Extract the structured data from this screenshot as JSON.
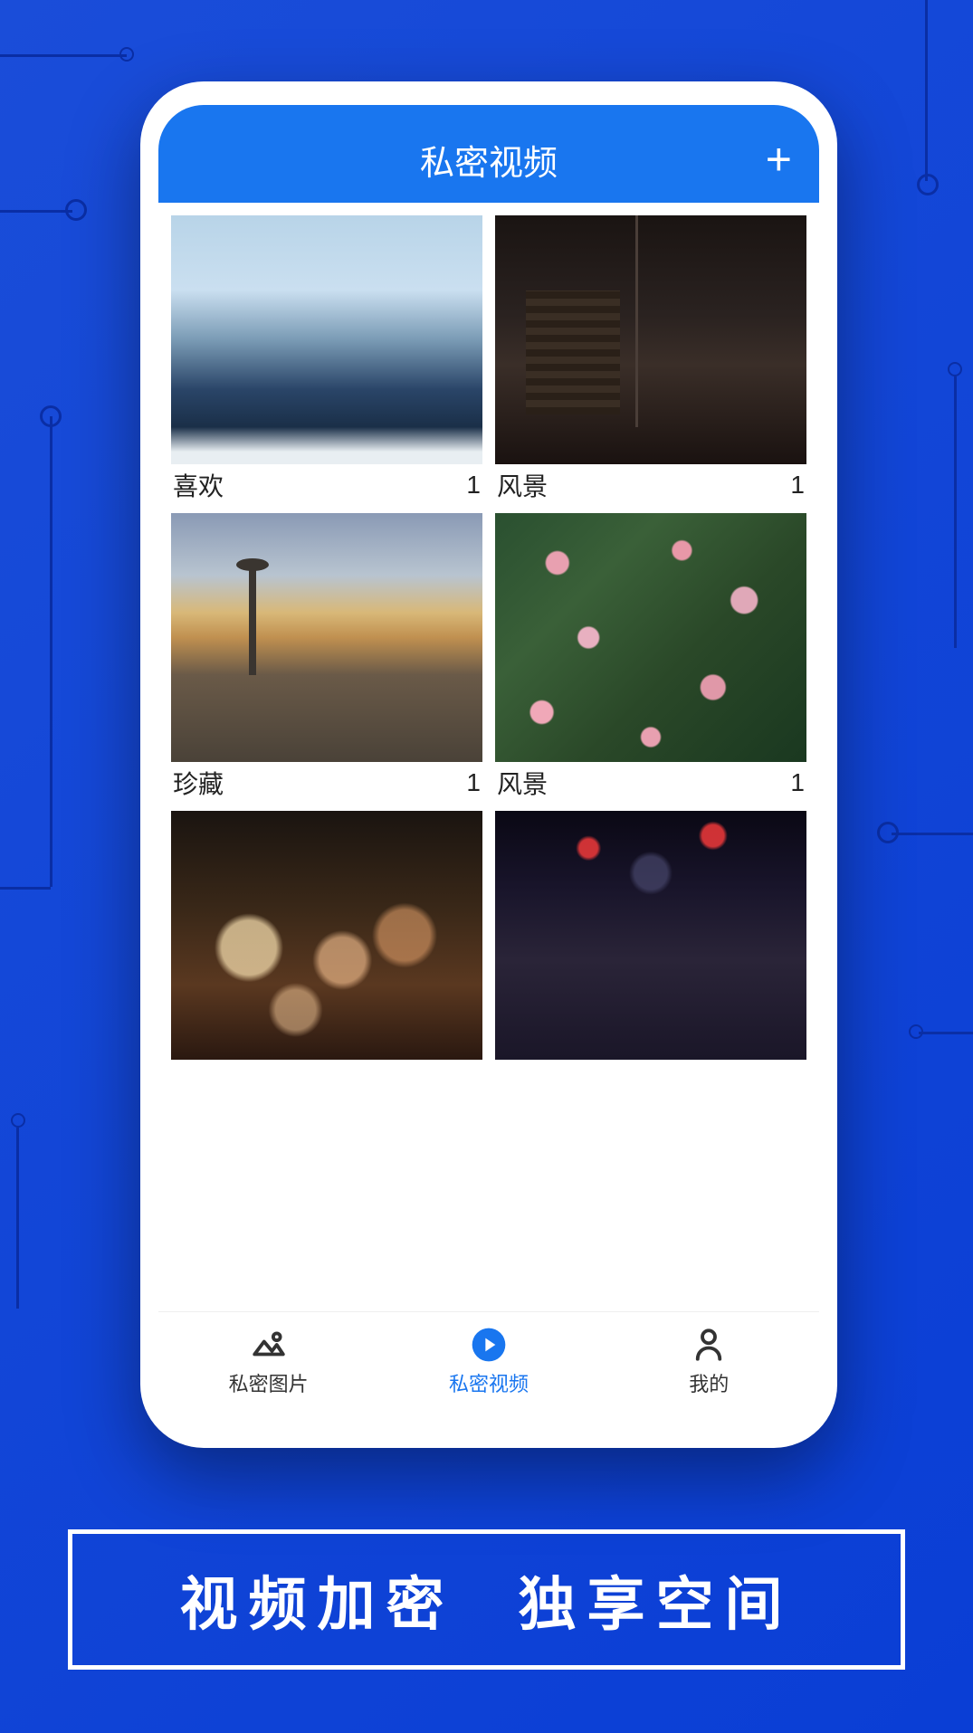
{
  "header": {
    "title": "私密视频",
    "add_icon": "plus-icon"
  },
  "albums": [
    {
      "label": "喜欢",
      "count": "1",
      "thumb": "mountains"
    },
    {
      "label": "风景",
      "count": "1",
      "thumb": "building"
    },
    {
      "label": "珍藏",
      "count": "1",
      "thumb": "city"
    },
    {
      "label": "风景",
      "count": "1",
      "thumb": "flowers"
    },
    {
      "label": "",
      "count": "",
      "thumb": "bokeh"
    },
    {
      "label": "",
      "count": "",
      "thumb": "crowd"
    }
  ],
  "nav": {
    "items": [
      {
        "label": "私密图片",
        "icon": "image-icon",
        "active": false
      },
      {
        "label": "私密视频",
        "icon": "play-icon",
        "active": true
      },
      {
        "label": "我的",
        "icon": "person-icon",
        "active": false
      }
    ]
  },
  "tagline": {
    "left": "视频加密",
    "right": "独享空间"
  },
  "colors": {
    "accent": "#1976ef",
    "bg": "#1a4dd9"
  }
}
